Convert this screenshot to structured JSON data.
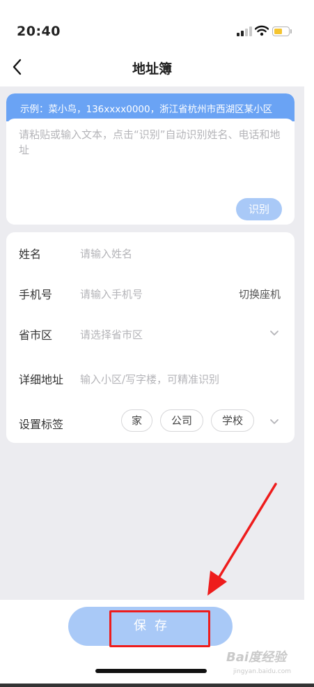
{
  "status_bar": {
    "time": "20:40",
    "battery_color": "#f4c430"
  },
  "nav": {
    "title": "地址簿",
    "back_icon": "chevron-left-icon"
  },
  "paste_card": {
    "example": "示例：菜小鸟，136xxxx0000，浙江省杭州市西湖区某小区",
    "placeholder": "请粘贴或输入文本，点击“识别”自动识别姓名、电话和地址",
    "recognize_label": "识别"
  },
  "form": {
    "name": {
      "label": "姓名",
      "placeholder": "请输入姓名"
    },
    "phone": {
      "label": "手机号",
      "placeholder": "请输入手机号",
      "switch_label": "切换座机"
    },
    "region": {
      "label": "省市区",
      "placeholder": "请选择省市区"
    },
    "address": {
      "label": "详细地址",
      "placeholder": "输入小区/写字楼，可精准识别"
    },
    "tags": {
      "label": "设置标签",
      "options": [
        "家",
        "公司",
        "学校"
      ]
    }
  },
  "bottom": {
    "save_label": "保存"
  },
  "watermark": {
    "brand": "Bai度经验",
    "url": "jingyan.baidu.com"
  },
  "colors": {
    "accent": "#6aa3f4",
    "button_disabled": "#a9c9f7",
    "annotation_red": "#ee1c1c",
    "background_gray": "#ececf0"
  }
}
